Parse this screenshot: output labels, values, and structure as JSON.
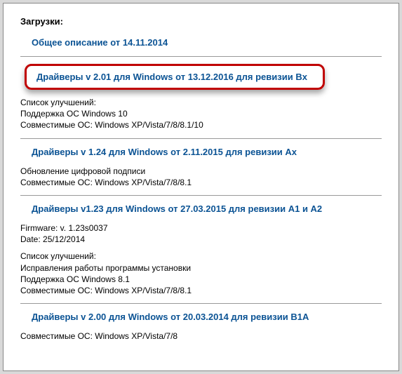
{
  "heading": "Загрузки:",
  "items": [
    {
      "title": "Общее описание от 14.11.2014",
      "highlighted": false,
      "desc": []
    },
    {
      "title": "Драйверы v 2.01 для Windows от 13.12.2016 для ревизии Bx",
      "highlighted": true,
      "desc": [
        "Список улучшений:",
        "Поддержка ОС Windows 10",
        "Совместимые ОС: Windows XP/Vista/7/8/8.1/10"
      ]
    },
    {
      "title": "Драйверы v 1.24 для Windows от 2.11.2015 для ревизии Ax",
      "highlighted": false,
      "desc": [
        "Обновление цифровой подписи",
        "Совместимые ОС: Windows XP/Vista/7/8/8.1"
      ]
    },
    {
      "title": "Драйверы v1.23 для Windows от 27.03.2015 для ревизии A1 и A2",
      "highlighted": false,
      "desc": [
        "Firmware: v. 1.23s0037",
        "Date: 25/12/2014",
        "",
        "Список улучшений:",
        "Исправления работы программы установки",
        "Поддержка ОС Windows 8.1",
        "Совместимые ОС: Windows XP/Vista/7/8/8.1"
      ]
    },
    {
      "title": "Драйверы v 2.00 для Windows от 20.03.2014 для ревизии B1A",
      "highlighted": false,
      "desc": [
        "Совместимые ОС: Windows XP/Vista/7/8"
      ]
    }
  ]
}
